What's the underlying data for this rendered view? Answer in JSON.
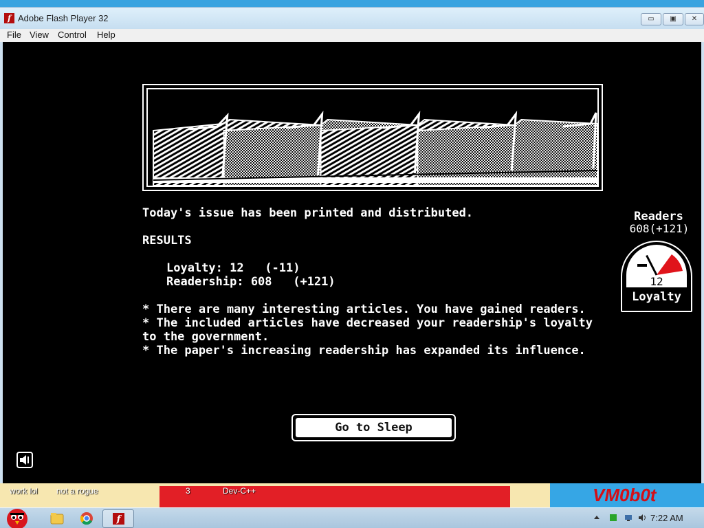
{
  "window": {
    "title": "Adobe Flash Player 32",
    "minimize_symbol": "▭",
    "maximize_symbol": "▣",
    "close_symbol": "✕"
  },
  "menu": {
    "file": "File",
    "view": "View",
    "control": "Control",
    "help": "Help"
  },
  "game": {
    "issue_line": "Today's issue has been printed and distributed.",
    "results_title": "RESULTS",
    "loyalty_line": "Loyalty: 12   (-11)",
    "readership_line": "Readership: 608   (+121)",
    "notes": [
      "* There are many interesting articles. You have gained readers.",
      "* The included articles have decreased your readership's loyalty to the government.",
      "* The paper's increasing readership has expanded its influence."
    ],
    "sleep_button": "Go to Sleep",
    "readers_label": "Readers",
    "readers_value": "608(+121)",
    "gauge_value": "12",
    "gauge_label": "Loyalty",
    "gauge_level_fraction": 0.3,
    "gauge_accent": "#e0141b"
  },
  "desktop": {
    "icons": [
      "work lol",
      "not a rogue",
      "3",
      "Dev-C++"
    ],
    "brand": "VM0b0t"
  },
  "taskbar": {
    "clock": "7:22 AM",
    "apps": [
      "start-orb-icon",
      "explorer-icon",
      "chrome-icon",
      "flash-player-icon"
    ]
  }
}
